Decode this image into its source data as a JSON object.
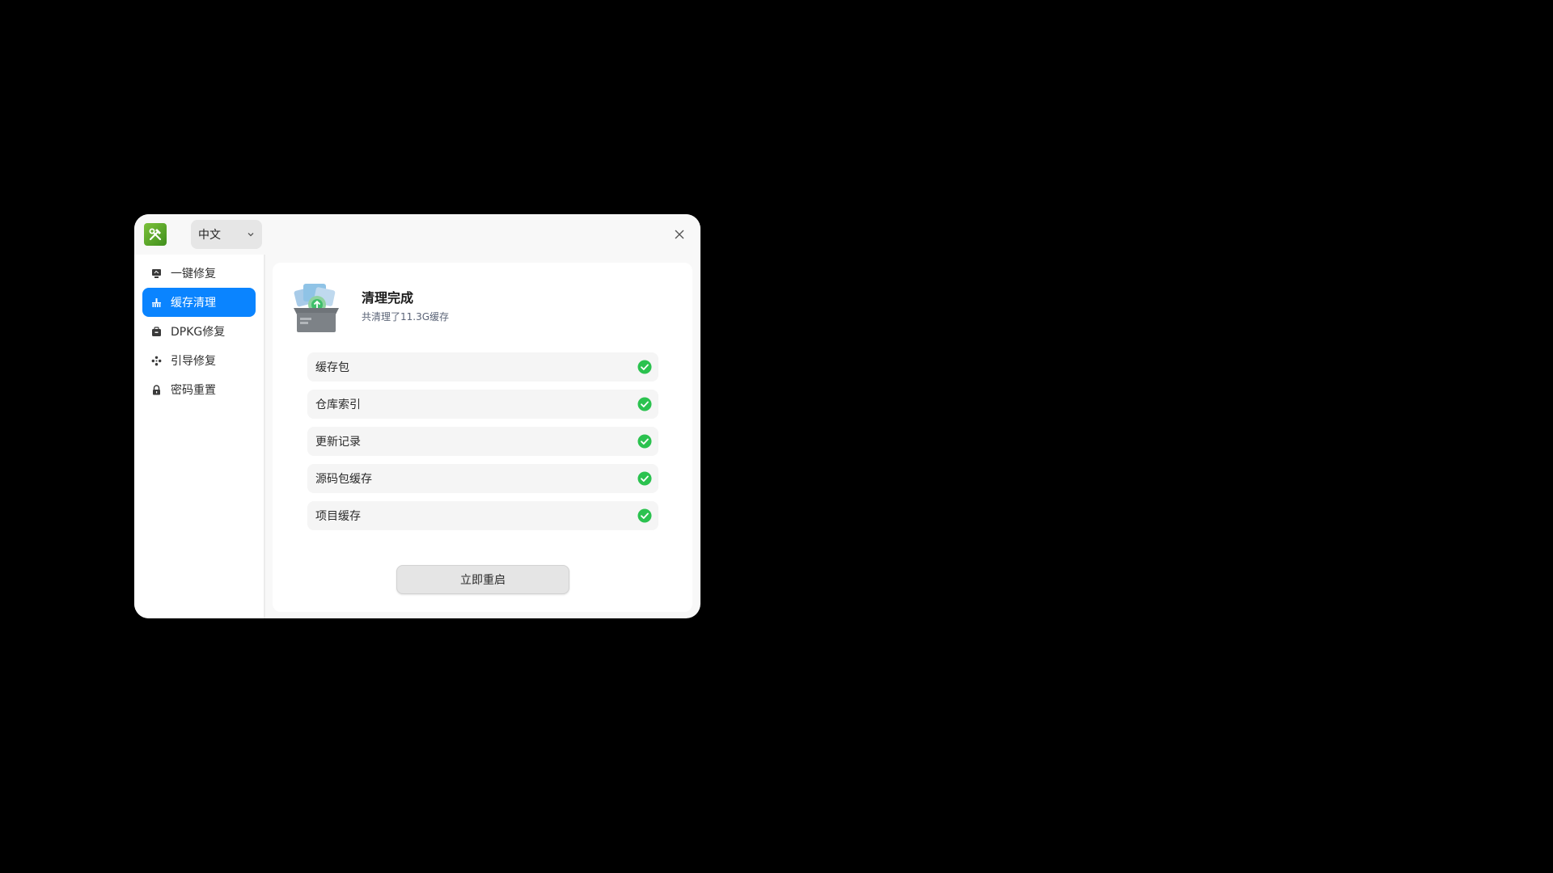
{
  "header": {
    "language": "中文"
  },
  "sidebar": {
    "items": [
      {
        "label": "一键修复",
        "icon": "monitor-icon",
        "active": false
      },
      {
        "label": "缓存清理",
        "icon": "broom-icon",
        "active": true
      },
      {
        "label": "DPKG修复",
        "icon": "package-icon",
        "active": false
      },
      {
        "label": "引导修复",
        "icon": "boot-icon",
        "active": false
      },
      {
        "label": "密码重置",
        "icon": "lock-icon",
        "active": false
      }
    ]
  },
  "main": {
    "title": "清理完成",
    "subtitle": "共清理了11.3G缓存",
    "items": [
      {
        "label": "缓存包",
        "status": "done"
      },
      {
        "label": "仓库索引",
        "status": "done"
      },
      {
        "label": "更新记录",
        "status": "done"
      },
      {
        "label": "源码包缓存",
        "status": "done"
      },
      {
        "label": "项目缓存",
        "status": "done"
      }
    ],
    "restart_label": "立即重启"
  },
  "colors": {
    "accent": "#0a84ff",
    "success": "#2bc24f",
    "background": "#000000",
    "window": "#f8f8f8"
  }
}
